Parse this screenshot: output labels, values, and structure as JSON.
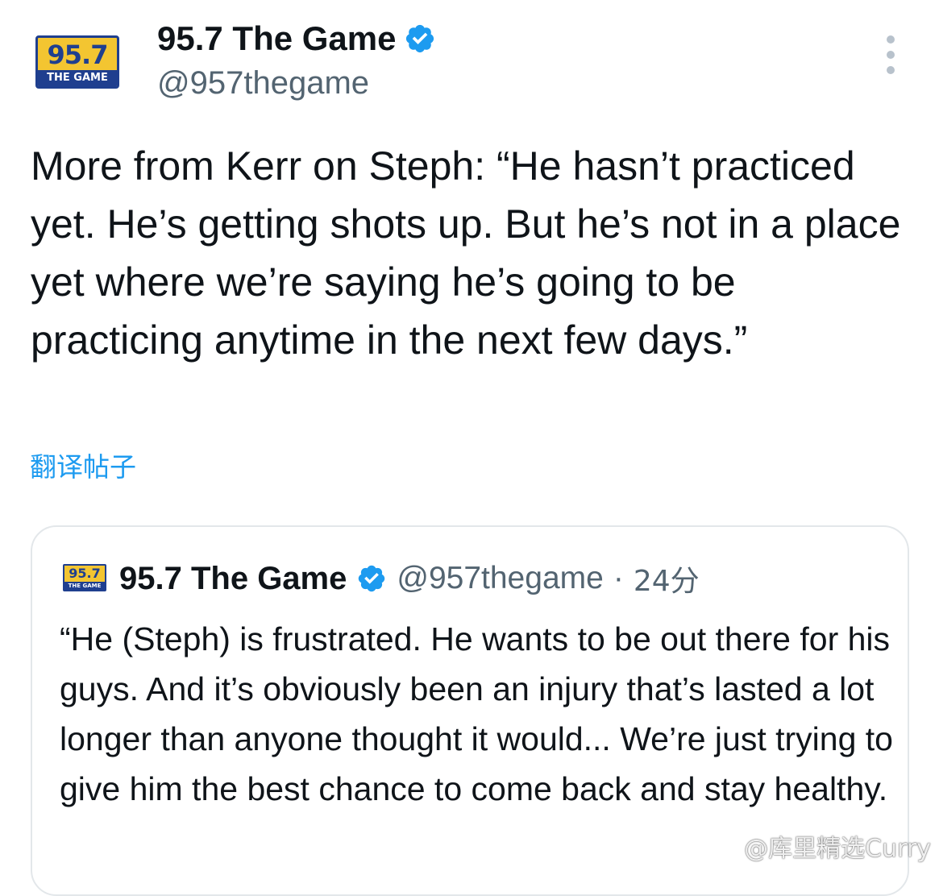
{
  "tweet": {
    "logo": {
      "number": "95.7",
      "subtitle": "THE GAME"
    },
    "author_name": "95.7 The Game",
    "author_handle": "@957thegame",
    "verified_icon": "verified-badge-icon",
    "more_icon": "more-options-icon",
    "text": "More from Kerr on Steph: “He hasn’t practiced yet. He’s getting shots up. But he’s not in a place yet where we’re saying he’s going to be practicing anytime in the next few days.”",
    "translate_label": "翻译帖子"
  },
  "quoted": {
    "logo": {
      "number": "95.7",
      "subtitle": "THE GAME"
    },
    "author_name": "95.7 The Game",
    "author_handle": "@957thegame",
    "separator": "·",
    "time": "24分",
    "text": "“He (Steph) is frustrated. He wants to be out there for his guys. And it’s obviously been an injury that’s lasted a lot longer than anyone thought it would... We’re just trying to give him the best chance to come back and stay healthy."
  },
  "watermark": {
    "text": "@库里精选Curry"
  },
  "colors": {
    "accent": "#1d9bf0",
    "text_primary": "#0f1419",
    "text_secondary": "#536471",
    "border": "#e3e7ea",
    "logo_yellow": "#f3c531",
    "logo_blue": "#1f3f8f"
  }
}
